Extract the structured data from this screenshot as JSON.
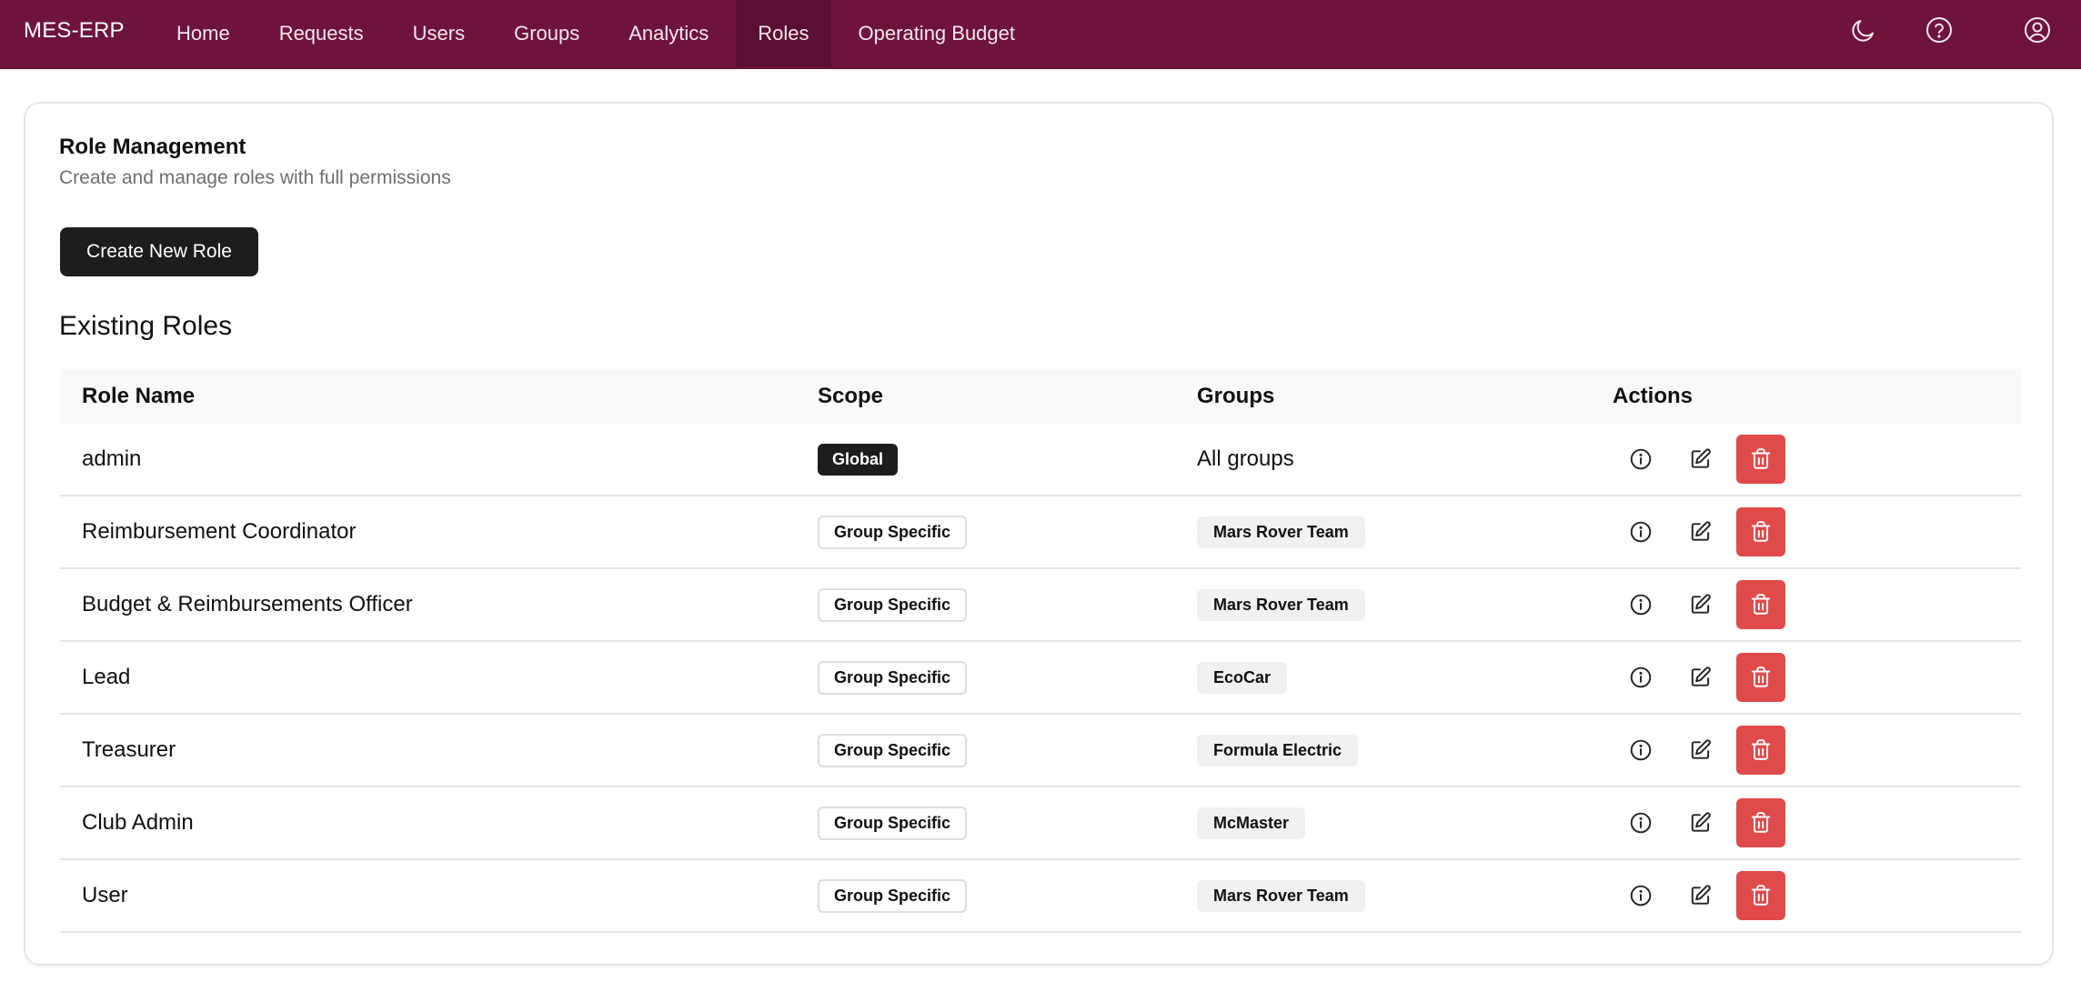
{
  "app": {
    "brand": "MES-ERP",
    "nav": [
      {
        "label": "Home",
        "active": false
      },
      {
        "label": "Requests",
        "active": false
      },
      {
        "label": "Users",
        "active": false
      },
      {
        "label": "Groups",
        "active": false
      },
      {
        "label": "Analytics",
        "active": false
      },
      {
        "label": "Roles",
        "active": true
      },
      {
        "label": "Operating Budget",
        "active": false
      }
    ],
    "right_icons": [
      "moon-icon",
      "help-icon",
      "user-account-icon"
    ],
    "colors": {
      "nav_bg": "#6e143c",
      "nav_active": "#5b0f31",
      "delete": "#e04a4a",
      "dark_button": "#1d1d1d"
    }
  },
  "card": {
    "title": "Role Management",
    "subtitle": "Create and manage roles with full permissions",
    "create_button": "Create New Role"
  },
  "section_title": "Existing Roles",
  "table": {
    "headers": {
      "name": "Role Name",
      "scope": "Scope",
      "groups": "Groups",
      "actions": "Actions"
    },
    "rows": [
      {
        "name": "admin",
        "scope": "Global",
        "groups": "All groups"
      },
      {
        "name": "Reimbursement Coordinator",
        "scope": "Group Specific",
        "groups": "Mars Rover Team"
      },
      {
        "name": "Budget & Reimbursements Officer",
        "scope": "Group Specific",
        "groups": "Mars Rover Team"
      },
      {
        "name": "Lead",
        "scope": "Group Specific",
        "groups": "EcoCar"
      },
      {
        "name": "Treasurer",
        "scope": "Group Specific",
        "groups": "Formula Electric"
      },
      {
        "name": "Club Admin",
        "scope": "Group Specific",
        "groups": "McMaster"
      },
      {
        "name": "User",
        "scope": "Group Specific",
        "groups": "Mars Rover Team"
      }
    ],
    "action_icons": [
      "info-icon",
      "edit-icon",
      "trash-icon"
    ]
  }
}
